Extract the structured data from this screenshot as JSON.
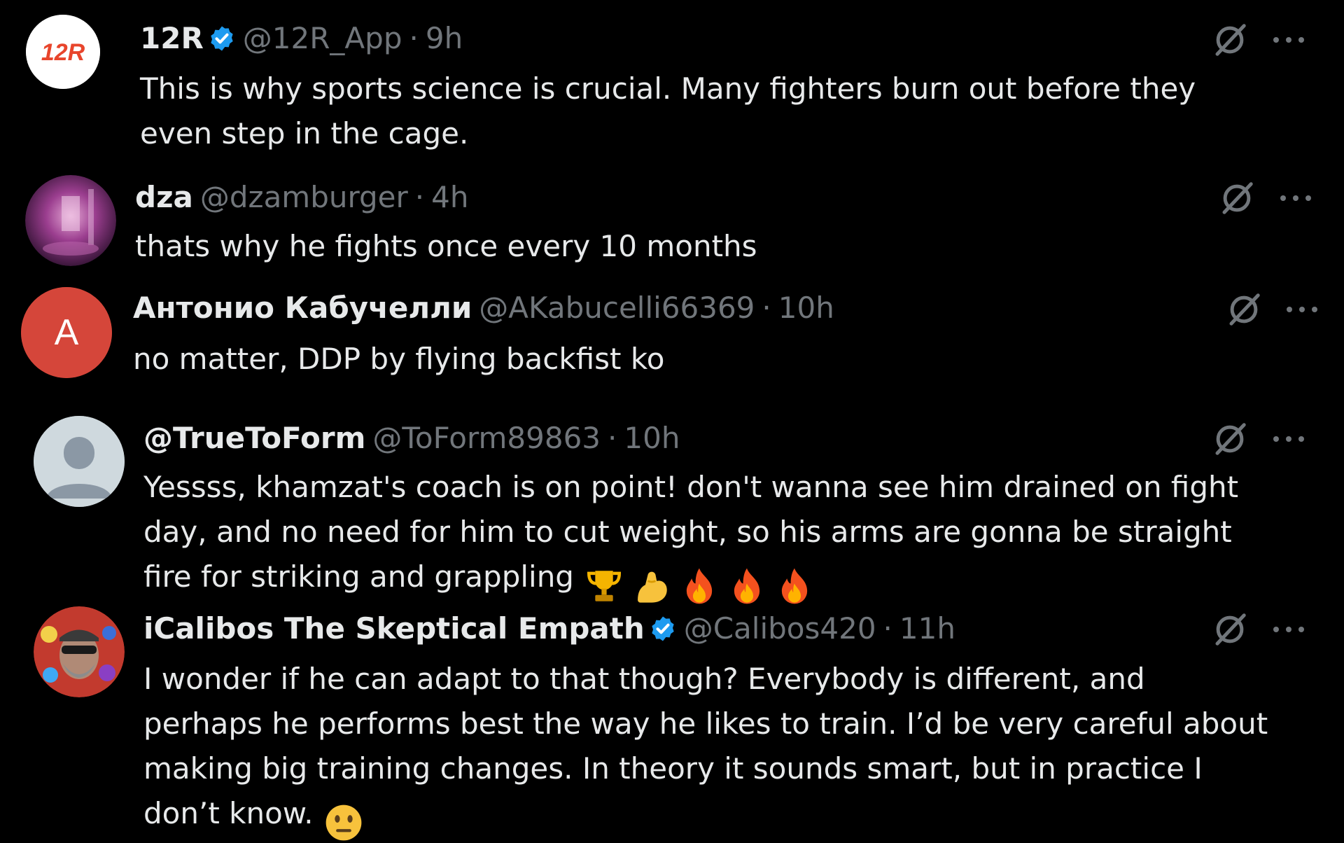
{
  "tweets": [
    {
      "display_name": "12R",
      "verified": true,
      "handle": "@12R_App",
      "time": "9h",
      "avatar_text": "12R",
      "lines": [
        "This is why sports science is crucial. Many fighters burn out before they",
        "even step in the cage."
      ]
    },
    {
      "display_name": "dza",
      "verified": false,
      "handle": "@dzamburger",
      "time": "4h",
      "lines": [
        "thats why he fights once every 10 months"
      ]
    },
    {
      "display_name": "Антонио Кабучелли",
      "verified": false,
      "handle": "@AKabucelli66369",
      "time": "10h",
      "avatar_text": "A",
      "lines": [
        "no matter, DDP by flying backfist ko"
      ]
    },
    {
      "display_name": "@TrueToForm",
      "verified": false,
      "handle": "@ToForm89863",
      "time": "10h",
      "lines": [
        "Yessss, khamzat's coach is on point! don't wanna see him drained on fight",
        "day, and no need for him to cut weight, so his arms are gonna be straight",
        "fire for striking and grappling"
      ],
      "emojis": [
        "trophy-emoji",
        "flexed-biceps-emoji",
        "fire-emoji",
        "fire-emoji",
        "fire-emoji"
      ]
    },
    {
      "display_name": "iCalibos The Skeptical Empath",
      "verified": true,
      "handle": "@Calibos420",
      "time": "11h",
      "lines": [
        "I wonder if he can adapt to that though? Everybody is different, and",
        "perhaps he performs best the way he likes to train. I’d be very careful about",
        "making big training changes. In theory it sounds smart, but in practice I",
        "don’t know."
      ],
      "emojis": [
        "neutral-face-emoji"
      ]
    }
  ],
  "separator": "·",
  "colors": {
    "background": "#000000",
    "text": "#e7e9ea",
    "muted": "#71767b",
    "verified_blue": "#1d9bf0",
    "brand_12r": "#e8452c",
    "avatar_a": "#d5463a"
  },
  "icons": {
    "action": "grok-icon",
    "menu": "more-icon"
  }
}
